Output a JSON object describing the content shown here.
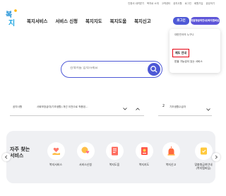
{
  "utility_links": [
    "인증서 내려받기",
    "복지로 소개",
    "고객센터",
    "공지사항",
    "로그인",
    "회원가입",
    "공유하기"
  ],
  "logo_text": "복지로",
  "gnb": [
    "복지서비스",
    "서비스 신청",
    "복지지도",
    "복지도움",
    "복지신고"
  ],
  "login_label": "로그인",
  "benefit_button_label": "맞춤형급여안내(복지멤버십)",
  "dropdown": {
    "header": "대한민국의 누구나",
    "highlighted_item": "제도 안내",
    "item_3": "받을 가능성이 있는 서비스"
  },
  "search": {
    "placeholder": "검색어를 입력하세요"
  },
  "filter": {
    "label": "공지사항",
    "value": "사회보장급여(기초생활) 개선 이전으로 적용된...",
    "page": "2",
    "page_label": "기초생활수급자"
  },
  "services": {
    "title_line1": "자주 찾는",
    "title_line2": "서비스",
    "items": [
      {
        "label": "복지서비스",
        "icon": "hand-heart-icon"
      },
      {
        "label": "서비스신청",
        "icon": "bubble-heart-icon"
      },
      {
        "label": "복지도움",
        "icon": "document-icon"
      },
      {
        "label": "복지지도",
        "icon": "map-icon"
      },
      {
        "label": "복지신고",
        "icon": "siren-icon"
      },
      {
        "label": "맞춤형급여안내",
        "label2": "(복지멤버십)",
        "icon": "bell-icon"
      }
    ]
  },
  "colors": {
    "primary": "#4e59d6",
    "accent_red": "#e60012"
  }
}
